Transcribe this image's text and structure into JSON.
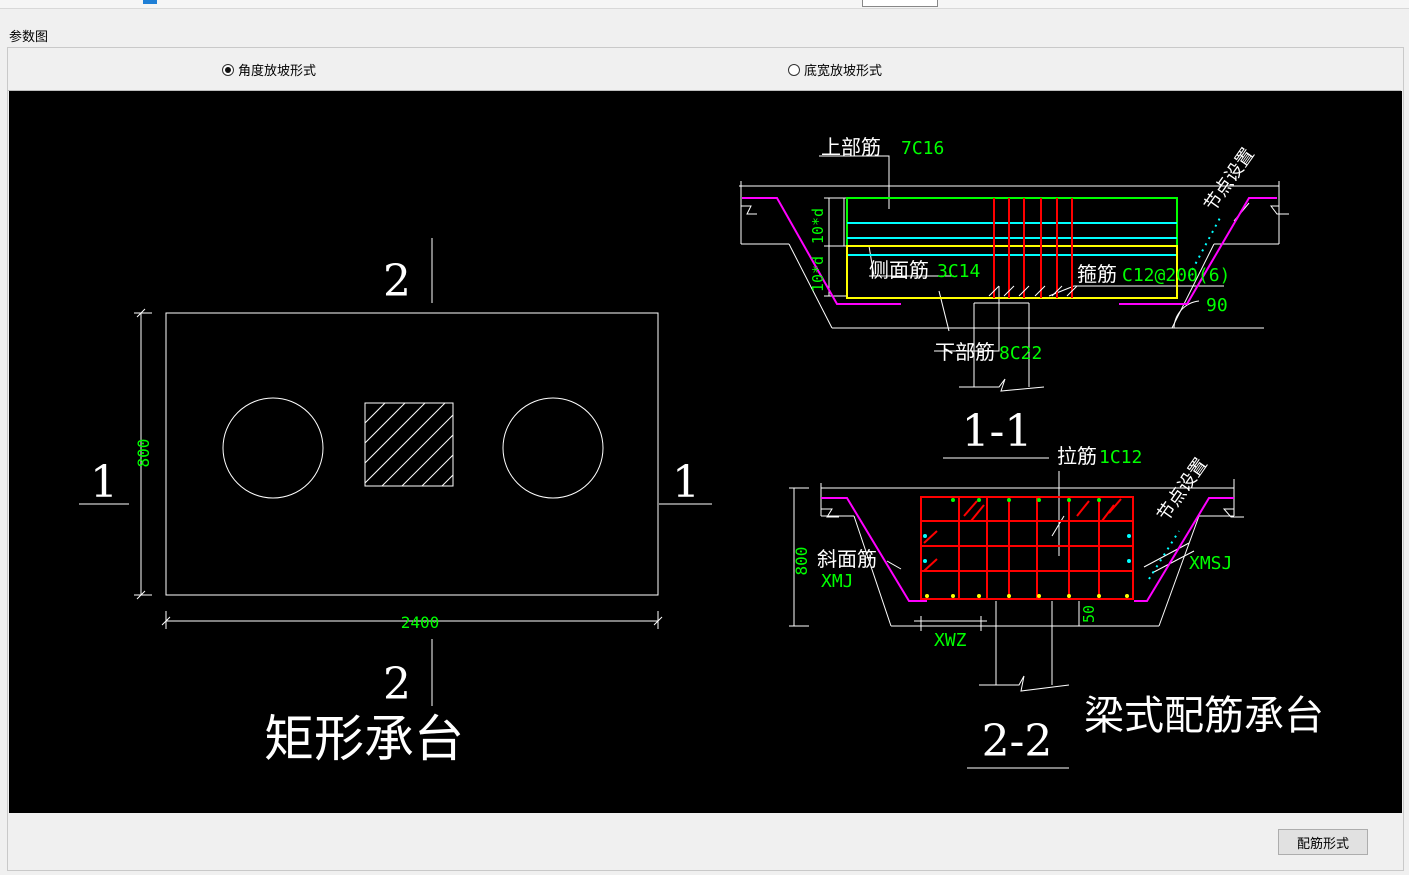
{
  "panel": {
    "title": "参数图"
  },
  "radios": [
    {
      "label": "角度放坡形式",
      "checked": true
    },
    {
      "label": "底宽放坡形式",
      "checked": false
    }
  ],
  "drawing": {
    "plan": {
      "section_mark_top": "2",
      "section_mark_bottom": "2",
      "section_mark_left": "1",
      "section_mark_right": "1",
      "dim_height": "800",
      "dim_width": "2400",
      "caption": "矩形承台"
    },
    "section_1_1": {
      "label": "1-1",
      "top_bar_label": "上部筋",
      "top_bar_value": "7C16",
      "side_bar_label": "侧面筋",
      "side_bar_value": "3C14",
      "stirrup_label": "箍筋",
      "stirrup_value": "C12@200(6)",
      "bottom_bar_label": "下部筋",
      "bottom_bar_value": "8C22",
      "dim_10d_a": "10*d",
      "dim_10d_b": "10*d",
      "node_setting": "节点设置",
      "angle": "90"
    },
    "section_2_2": {
      "label": "2-2",
      "tie_bar_label": "拉筋",
      "tie_bar_value": "1C12",
      "slope_bar_label": "斜面筋",
      "slope_bar_value": "XMJ",
      "node_setting": "节点设置",
      "xmsj": "XMSJ",
      "xwz": "XWZ",
      "dim_800": "800",
      "dim_50": "50"
    },
    "caption_right": "梁式配筋承台"
  },
  "buttons": {
    "rebar_form": "配筋形式"
  },
  "colors": {
    "white": "#ffffff",
    "green": "#00ff00",
    "magenta": "#ff00ff",
    "cyan": "#00ffff",
    "yellow": "#ffff00",
    "red": "#ff0000"
  }
}
